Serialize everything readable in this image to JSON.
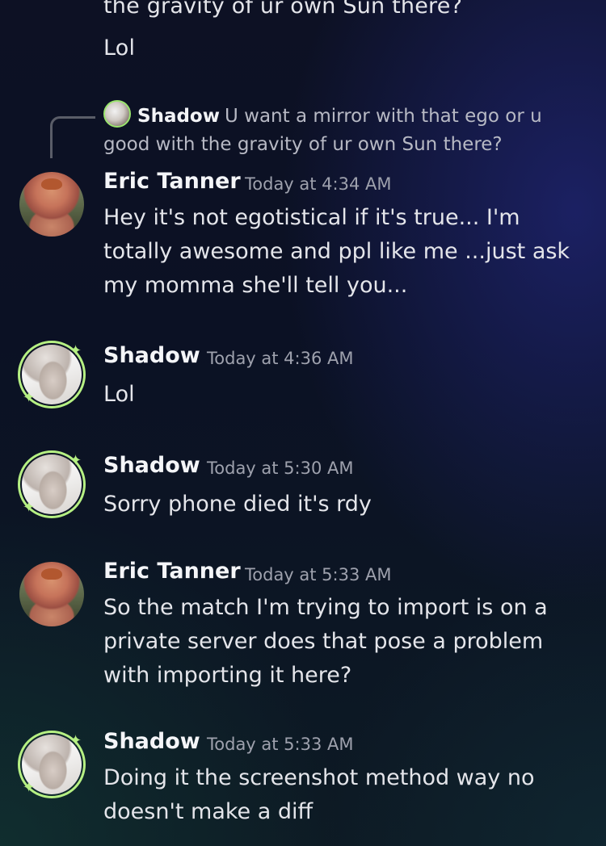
{
  "top_context": {
    "line_partial": "the gravity of ur own Sun there?",
    "line_lol": "Lol"
  },
  "reply_preview": {
    "author": "Shadow",
    "text": "U want a mirror with that ego or u good with the gravity of ur own Sun there?"
  },
  "messages": [
    {
      "author": "Eric Tanner",
      "timestamp": "Today at 4:34 AM",
      "text": "Hey it's not egotistical if it's true... I'm totally awesome and ppl like me ...just ask my momma she'll tell you..."
    },
    {
      "author": "Shadow",
      "timestamp": "Today at 4:36 AM",
      "text": "Lol"
    },
    {
      "author": "Shadow",
      "timestamp": "Today at 5:30 AM",
      "text": "Sorry phone died it's rdy"
    },
    {
      "author": "Eric Tanner",
      "timestamp": "Today at 5:33 AM",
      "text": "So the match I'm trying to import is on a private server does that pose a problem with importing it here?"
    },
    {
      "author": "Shadow",
      "timestamp": "Today at 5:33 AM",
      "text": "Doing it the screenshot method way no doesn't make a diff"
    }
  ],
  "colors": {
    "background": "#0b1124",
    "text": "#e4e5ea",
    "muted": "#9ea1ad",
    "avatar_ring": "#b6f083"
  },
  "icons": {
    "sparkle": "sparkle-icon",
    "reply": "reply-spine-icon"
  }
}
